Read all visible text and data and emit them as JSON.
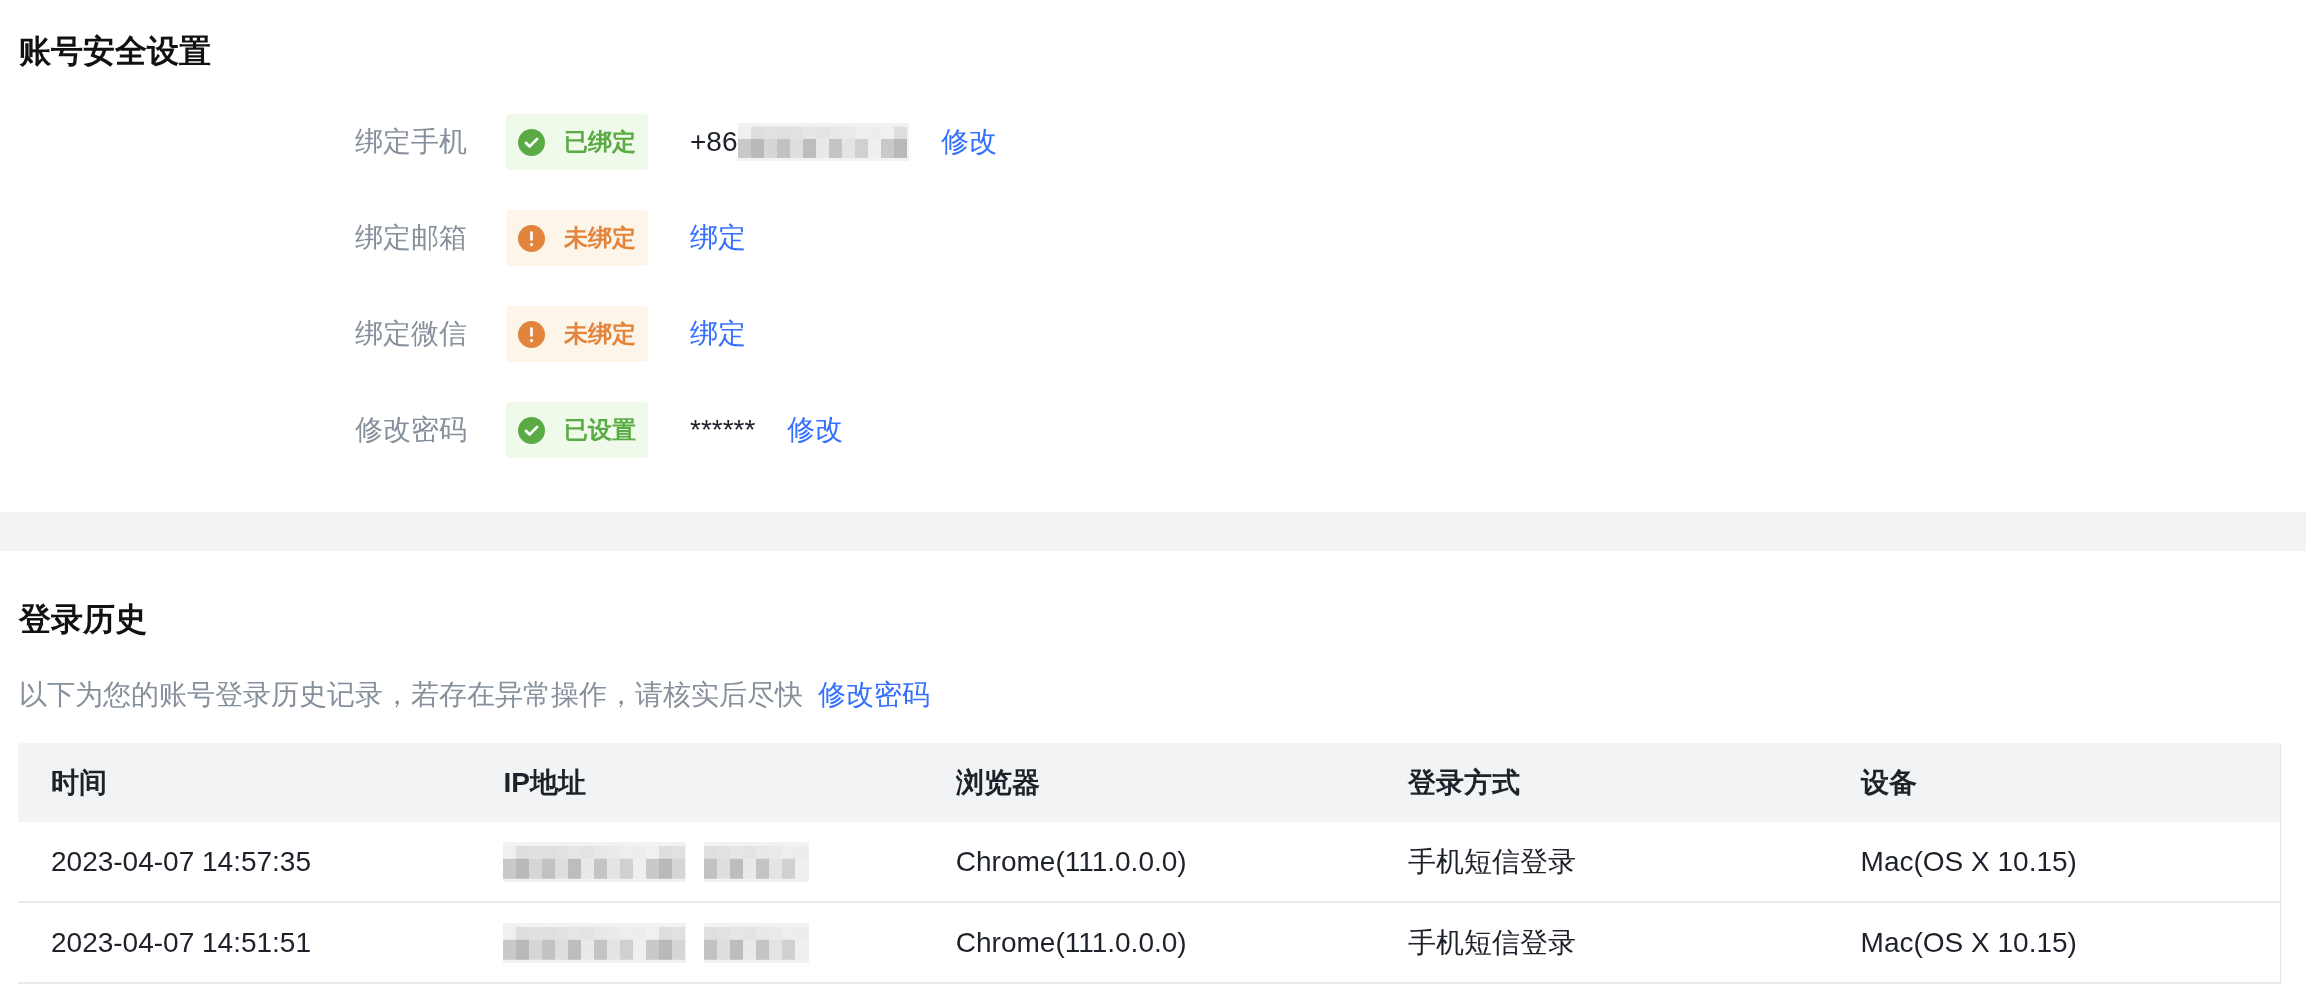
{
  "account_security": {
    "title": "账号安全设置",
    "items": [
      {
        "label": "绑定手机",
        "status": {
          "kind": "success",
          "text": "已绑定"
        },
        "value": "+86",
        "redacted": true,
        "action": "修改"
      },
      {
        "label": "绑定邮箱",
        "status": {
          "kind": "warning",
          "text": "未绑定"
        },
        "redacted": false,
        "action": "绑定"
      },
      {
        "label": "绑定微信",
        "status": {
          "kind": "warning",
          "text": "未绑定"
        },
        "redacted": false,
        "action": "绑定"
      },
      {
        "label": "修改密码",
        "status": {
          "kind": "success",
          "text": "已设置"
        },
        "value": "******",
        "redacted": false,
        "action": "修改"
      }
    ]
  },
  "login_history": {
    "title": "登录历史",
    "description": "以下为您的账号登录历史记录，若存在异常操作，请核实后尽快",
    "description_link": "修改密码",
    "table": {
      "columns": [
        "时间",
        "IP地址",
        "浏览器",
        "登录方式",
        "设备"
      ],
      "rows": [
        {
          "time": "2023-04-07 14:57:35",
          "ip_redacted": true,
          "browser": "Chrome(111.0.0.0)",
          "login_method": "手机短信登录",
          "device": "Mac(OS X 10.15)"
        },
        {
          "time": "2023-04-07 14:51:51",
          "ip_redacted": true,
          "browser": "Chrome(111.0.0.0)",
          "login_method": "手机短信登录",
          "device": "Mac(OS X 10.15)"
        }
      ]
    }
  }
}
